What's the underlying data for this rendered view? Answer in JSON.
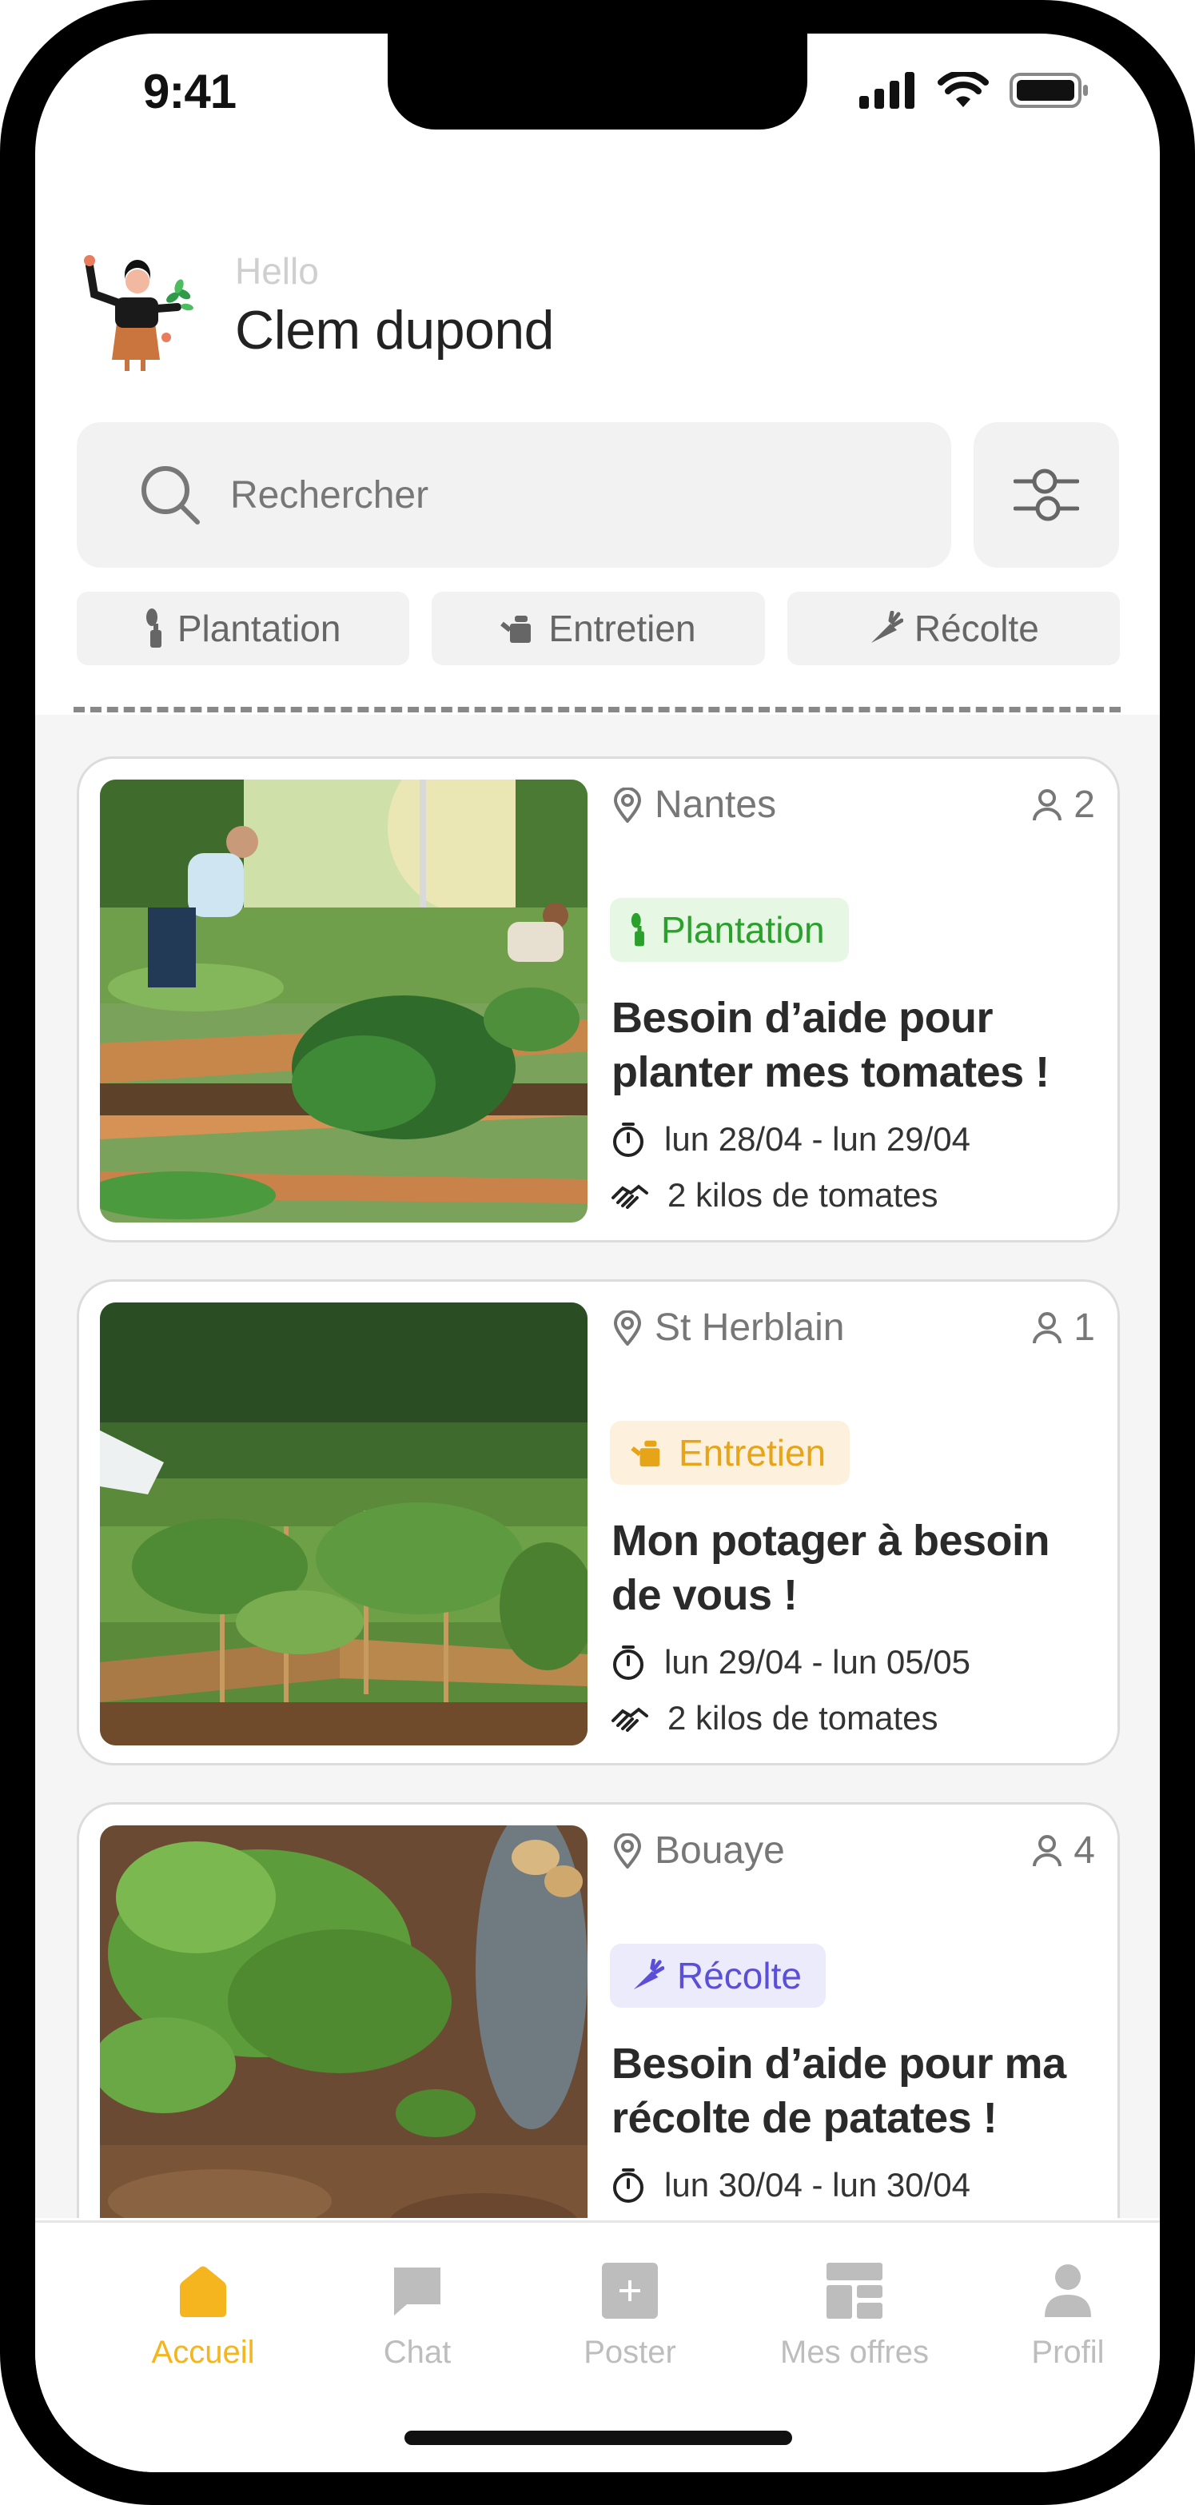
{
  "status_bar": {
    "time": "9:41"
  },
  "header": {
    "greeting": "Hello",
    "user_name": "Clem dupond"
  },
  "search": {
    "placeholder": "Rechercher"
  },
  "filters": [
    {
      "label": "Plantation",
      "icon": "sprout-icon"
    },
    {
      "label": "Entretien",
      "icon": "watering-can-icon"
    },
    {
      "label": "Récolte",
      "icon": "carrot-icon"
    }
  ],
  "colors": {
    "plantation_bg": "#e6f7e4",
    "plantation_fg": "#2ca02c",
    "entretien_bg": "#fdf1de",
    "entretien_fg": "#e6a519",
    "recolte_bg": "#ecebfb",
    "recolte_fg": "#5a4fd6",
    "active_tab": "#f4b51e"
  },
  "offers": [
    {
      "location": "Nantes",
      "people": "2",
      "category": "Plantation",
      "title": "Besoin d’aide pour planter mes tomates !",
      "dates": "lun 28/04 - lun 29/04",
      "reward": "2 kilos de tomates",
      "image": "garden-beds-with-people-photo"
    },
    {
      "location": "St Herblain",
      "people": "1",
      "category": "Entretien",
      "title": "Mon potager à besoin de vous !",
      "dates": "lun 29/04 - lun 05/05",
      "reward": "2 kilos de tomates",
      "image": "vegetable-garden-photo"
    },
    {
      "location": "Bouaye",
      "people": "4",
      "category": "Récolte",
      "title": "Besoin d’aide pour ma récolte de patates !",
      "dates": "lun 30/04 - lun 30/04",
      "reward": "",
      "image": "potato-harvest-photo"
    }
  ],
  "tabs": [
    {
      "label": "Accueil",
      "icon": "home-icon",
      "active": true
    },
    {
      "label": "Chat",
      "icon": "chat-icon",
      "active": false
    },
    {
      "label": "Poster",
      "icon": "plus-square-icon",
      "active": false
    },
    {
      "label": "Mes offres",
      "icon": "dashboard-icon",
      "active": false
    },
    {
      "label": "Profil",
      "icon": "user-icon",
      "active": false
    }
  ]
}
